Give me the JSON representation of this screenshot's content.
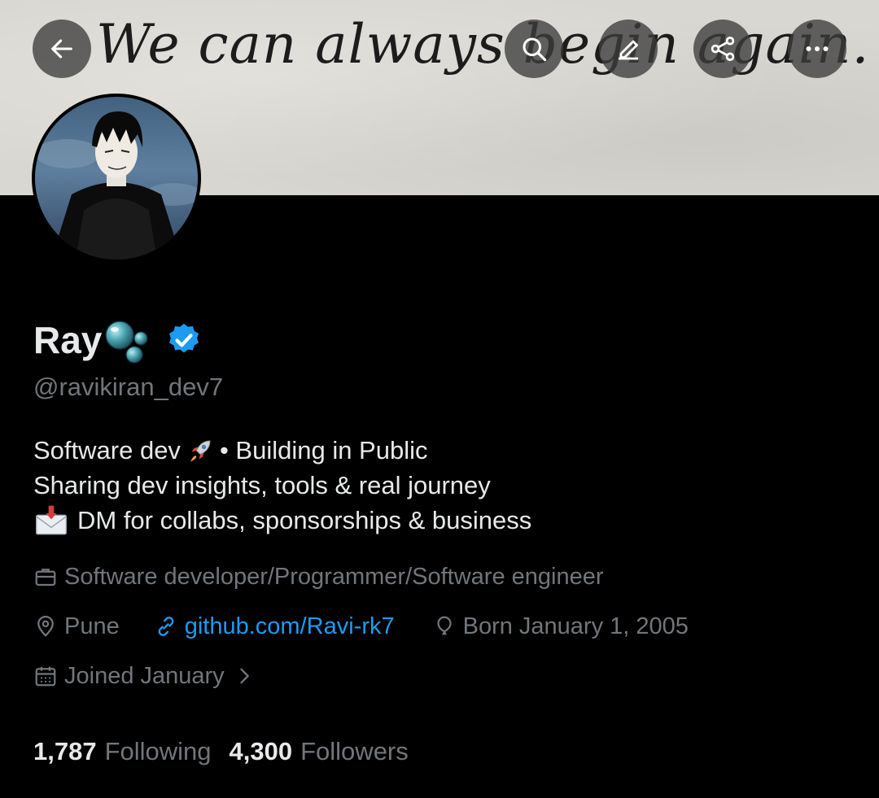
{
  "banner": {
    "text": "We can always begin again."
  },
  "header_buttons": {
    "back": "back-arrow-icon",
    "search": "search-icon",
    "edit": "pencil-icon",
    "share": "share-icon",
    "more": "more-dots-icon"
  },
  "profile": {
    "display_name": "Ray",
    "name_emoji": "bubbles-icon",
    "verified": "verified-badge-icon",
    "handle": "@ravikiran_dev7",
    "bio": {
      "line1_a": "Software dev",
      "line1_emoji": "rocket-icon",
      "line1_b": "• Building in Public",
      "line2": "Sharing dev insights, tools & real journey",
      "line3_emoji": "envelope-arrow-icon",
      "line3": "DM for collabs, sponsorships & business"
    },
    "profession": "Software developer/Programmer/Software engineer",
    "location": "Pune",
    "website": "github.com/Ravi-rk7",
    "birthday": "Born January 1, 2005",
    "joined": "Joined January"
  },
  "stats": {
    "following_count": "1,787",
    "following_label": "Following",
    "followers_count": "4,300",
    "followers_label": "Followers"
  },
  "colors": {
    "background": "#000000",
    "text_primary": "#e7e9ea",
    "text_secondary": "#71767b",
    "link": "#1d9bf0",
    "verified": "#1d9bf0"
  }
}
